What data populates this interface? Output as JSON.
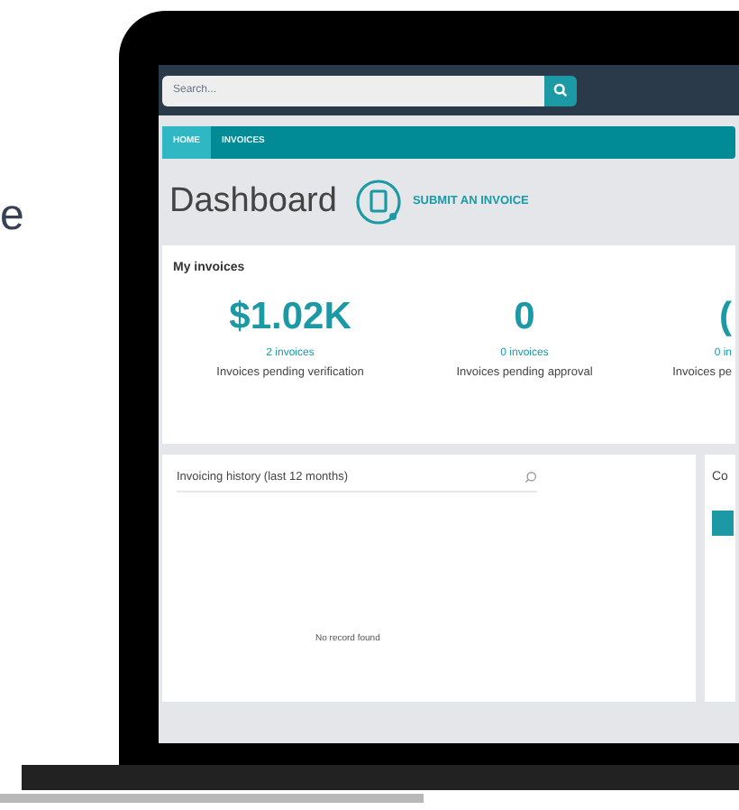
{
  "side_text": "e",
  "search": {
    "placeholder": "Search..."
  },
  "tabs": [
    {
      "label": "HOME",
      "selected": true
    },
    {
      "label": "INVOICES",
      "selected": false
    }
  ],
  "page_title": "Dashboard",
  "action": {
    "label": "SUBMIT AN INVOICE"
  },
  "my_invoices": {
    "title": "My invoices",
    "stats": [
      {
        "value": "$1.02K",
        "count": "2 invoices",
        "label": "Invoices pending verification"
      },
      {
        "value": "0",
        "count": "0 invoices",
        "label": "Invoices pending approval"
      },
      {
        "value": "(",
        "count": "0 in",
        "label": "Invoices pe"
      }
    ]
  },
  "history": {
    "title": "Invoicing history (last 12 months)",
    "empty": "No record found"
  },
  "side_panel": {
    "title": "Co"
  }
}
